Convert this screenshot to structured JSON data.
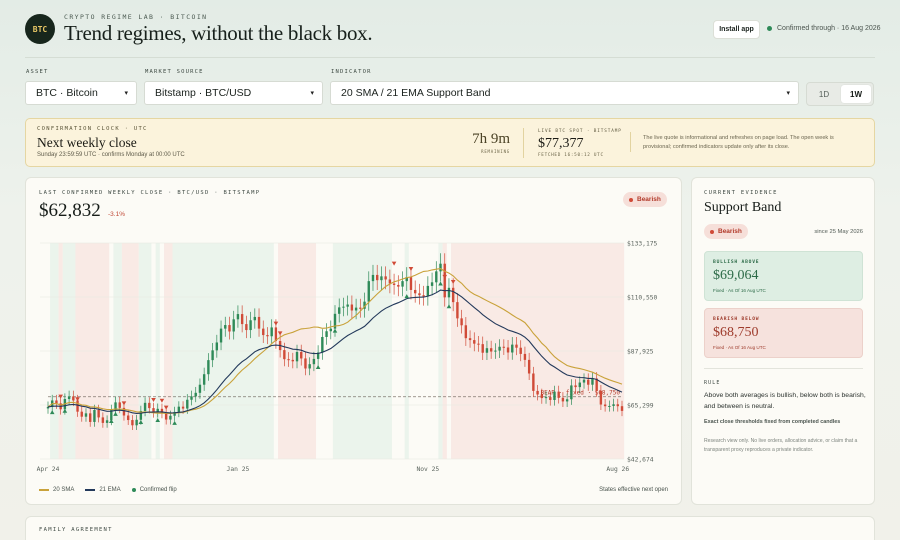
{
  "header": {
    "logo_text": "BTC",
    "eyebrow": "CRYPTO REGIME LAB · BITCOIN",
    "title": "Trend regimes, without the black box.",
    "install_label": "Install app",
    "confirmed_text": "Confirmed through · 16 Aug 2026",
    "confirmed_dot_color": "#2e8a58"
  },
  "controls": {
    "asset": {
      "label": "ASSET",
      "value": "BTC · Bitcoin"
    },
    "source": {
      "label": "MARKET SOURCE",
      "value": "Bitstamp · BTC/USD"
    },
    "indicator": {
      "label": "INDICATOR",
      "value": "20 SMA / 21 EMA Support Band"
    },
    "timeframes": [
      {
        "label": "1D",
        "active": false
      },
      {
        "label": "1W",
        "active": true
      }
    ]
  },
  "clock": {
    "label": "CONFIRMATION CLOCK · UTC",
    "title": "Next weekly close",
    "subtitle": "Sunday 23:59:59 UTC · confirms Monday at 00:00 UTC",
    "remaining": "7h 9m",
    "remaining_label": "REMAINING",
    "spot_label": "LIVE BTC SPOT · BITSTAMP",
    "spot_value": "$77,377",
    "fetched": "FETCHED 16:50:12 UTC",
    "note": "The live quote is informational and refreshes on page load. The open week is provisional; confirmed indicators update only after its close."
  },
  "chart_panel": {
    "label": "LAST CONFIRMED WEEKLY CLOSE · BTC/USD · BITSTAMP",
    "price": "$62,832",
    "change": "-3.1%",
    "status": "Bearish",
    "legend": [
      {
        "label": "20 SMA",
        "color": "#c9a23a"
      },
      {
        "label": "21 EMA",
        "color": "#23395b"
      },
      {
        "label": "Confirmed flip",
        "color": "#2e8a58"
      }
    ],
    "states_note": "States effective next open",
    "line_label": "BEAR · fixed · $68,750"
  },
  "chart_data": {
    "type": "candlestick",
    "x_tick_labels": [
      "Apr 24",
      "Jan 25",
      "Nov 25",
      "Aug 26"
    ],
    "y_tick_labels": [
      "$133,175",
      "$110,550",
      "$87,925",
      "$65,299",
      "$42,674"
    ],
    "ylim": [
      42674,
      133175
    ],
    "y_ticks": [
      133175,
      110550,
      87925,
      65299,
      42674
    ],
    "x_ticks_index": [
      0,
      45,
      90,
      135
    ],
    "closes": [
      64500,
      67200,
      66000,
      63500,
      67800,
      68900,
      67200,
      62500,
      60400,
      61800,
      58200,
      63200,
      60100,
      57800,
      58900,
      63200,
      66400,
      64100,
      60900,
      59000,
      56800,
      59100,
      62800,
      66200,
      64000,
      62200,
      63700,
      61900,
      59200,
      60800,
      62400,
      64600,
      63800,
      67500,
      68900,
      70400,
      73800,
      78200,
      84100,
      88200,
      91500,
      97300,
      98800,
      96100,
      101200,
      103400,
      99200,
      96700,
      100800,
      102200,
      97300,
      94600,
      94100,
      97800,
      92100,
      88300,
      84500,
      84200,
      83600,
      87500,
      84800,
      80600,
      82400,
      84600,
      87300,
      93800,
      96200,
      97300,
      103500,
      106200,
      106500,
      107400,
      104900,
      106100,
      105600,
      108600,
      117200,
      119800,
      117600,
      119200,
      117900,
      116200,
      115600,
      114900,
      117200,
      118900,
      113500,
      112100,
      111300,
      110800,
      115200,
      116700,
      121300,
      124500,
      110400,
      114400,
      108400,
      101600,
      98700,
      93300,
      92500,
      91000,
      90800,
      87200,
      89100,
      87700,
      88100,
      89700,
      89400,
      87300,
      90600,
      89300,
      86700,
      84200,
      78500,
      71200,
      69700,
      68200,
      68600,
      67400,
      70900,
      68300,
      66800,
      67700,
      73500,
      72800,
      74700,
      75900,
      73800,
      76400,
      71200,
      65500,
      64800,
      64900,
      65600,
      64800,
      62832
    ],
    "sma20": [
      64500,
      65850,
      65900,
      65300,
      65800,
      66317,
      66443,
      65950,
      65333,
      65180,
      64545,
      64508,
      64169,
      63714,
      63393,
      63381,
      63571,
      63606,
      63458,
      63235,
      62850,
      62445,
      62290,
      62425,
      62255,
      62020,
      61875,
      61845,
      61810,
      61765,
      61975,
      62045,
      62210,
      62695,
      63195,
      63550,
      64105,
      64920,
      66180,
      67650,
      69185,
      70995,
      72795,
      74305,
      76120,
      78170,
      79940,
      81380,
      82945,
      84715,
      86190,
      87695,
      89210,
      91000,
      92440,
      93680,
      94715,
      95265,
      95760,
      96515,
      97180,
      97365,
      97545,
      97970,
      97880,
      97455,
      97510,
      98065,
      98385,
      98585,
      99060,
      99990,
      101480,
      102805,
      104550,
      106580,
      108315,
      110095,
      111795,
      113385,
      114935,
      116015,
      116935,
      117425,
      118105,
      118630,
      118980,
      119690,
      120530,
      121280,
      121450,
      121900,
      122215,
      122460,
      121380,
      120575,
      119385,
      117625,
      116300,
      114375,
      112785,
      111650,
      110890,
      109915,
      108985,
      108065,
      107235,
      106315,
      105330,
      104230,
      103000,
      101880,
      100960,
      99835,
      97725,
      95285,
      93355,
      91175,
      89620,
      87425,
      85550,
      84155,
      82960,
      81860,
      81310,
      80870,
      80530,
      80140,
      79570,
      79030,
      78250,
      77330,
      76530,
      75870,
      75240,
      74670,
      74060
    ],
    "ema21": [
      64500,
      64745,
      64859,
      64736,
      65014,
      65369,
      65535,
      65259,
      64817,
      64543,
      63960,
      63890,
      63545,
      63023,
      62649,
      62700,
      63036,
      63133,
      62930,
      62573,
      62030,
      61765,
      61860,
      62163,
      62330,
      62317,
      62443,
      62396,
      62106,
      61988,
      62026,
      62260,
      62400,
      62955,
      63495,
      64118,
      65007,
      66206,
      67824,
      69675,
      71659,
      73896,
      76069,
      77891,
      79919,
      81871,
      83444,
      84668,
      86134,
      87594,
      88476,
      89033,
      89494,
      90248,
      90416,
      90223,
      89703,
      89204,
      88695,
      88586,
      88242,
      87547,
      87079,
      86853,
      86892,
      87384,
      88122,
      88992,
      90311,
      91755,
      93101,
      94400,
      95391,
      96364,
      97204,
      98240,
      99962,
      101766,
      103205,
      104658,
      105798,
      106681,
      107497,
      108143,
      108967,
      109896,
      110226,
      110396,
      110479,
      110510,
      110935,
      111458,
      112354,
      113458,
      113179,
      113290,
      112845,
      111822,
      110631,
      109147,
      107637,
      106125,
      104732,
      103120,
      101846,
      100560,
      99382,
      98502,
      97671,
      96728,
      96170,
      95546,
      94832,
      93688,
      92126,
      89853,
      87749,
      85703,
      83964,
      82265,
      81232,
      80055,
      78854,
      77856,
      77462,
      77037,
      76824,
      76725,
      76462,
      76452,
      75975,
      74932,
      73921,
      73010,
      72243,
      71476,
      70690
    ],
    "series": [
      {
        "name": "20 SMA",
        "color": "#c9a23a"
      },
      {
        "name": "21 EMA",
        "color": "#23395b"
      }
    ],
    "reference_line": {
      "value": 68750,
      "label": "BEAR · fixed · $68,750"
    }
  },
  "evidence": {
    "label": "CURRENT EVIDENCE",
    "title": "Support Band",
    "status": "Bearish",
    "since": "since 25 May 2026",
    "bullish": {
      "label": "BULLISH ABOVE",
      "value": "$69,064",
      "sub": "Fixed · As Of 16 Aug UTC"
    },
    "bearish": {
      "label": "BEARISH BELOW",
      "value": "$68,750",
      "sub": "Fixed · As Of 16 Aug UTC"
    },
    "rule_label": "RULE",
    "rule_text": "Above both averages is bullish, below both is bearish, and between is neutral.",
    "rule_bold": "Exact close thresholds fixed from completed candles",
    "rule_note": "Research view only. No live orders, allocation advice, or claim that a transparent proxy reproduces a private indicator."
  },
  "family": {
    "label": "FAMILY AGREEMENT"
  },
  "colors": {
    "bull": "#2e8a58",
    "bear": "#d04a37",
    "sma": "#c9a23a",
    "ema": "#23395b",
    "bull_band": "#e7f2ea",
    "bear_band": "#f8e6e2"
  }
}
